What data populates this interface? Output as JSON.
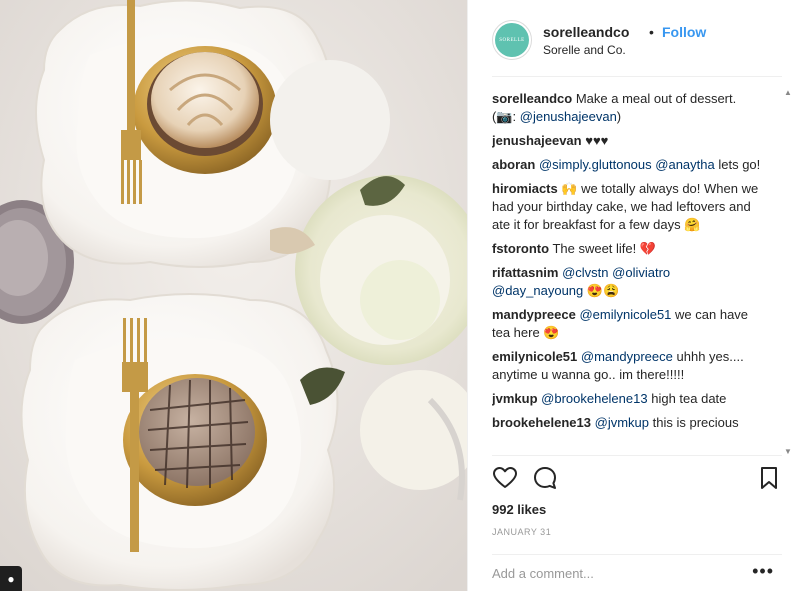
{
  "header": {
    "username": "sorelleandco",
    "separator": "•",
    "follow_label": "Follow",
    "subtitle": "Sorelle and Co.",
    "avatar_text": "SORELLE"
  },
  "caption": {
    "user": "sorelleandco",
    "text": "Make a meal out of dessert.",
    "text2_pre": "(📷: ",
    "text2_mention": "@jenushajeevan",
    "text2_post": ")"
  },
  "comments": [
    {
      "user": "jenushajeevan",
      "text": "♥♥♥"
    },
    {
      "user": "aboran",
      "m1": "@simply.gluttonous",
      "m2": "@anaytha",
      "text": "lets go!"
    },
    {
      "user": "hiromiacts",
      "text": "🙌 we totally always do! When we had your birthday cake, we had leftovers and ate it for breakfast for a few days 🤗"
    },
    {
      "user": "fstoronto",
      "text": "The sweet life! 💔"
    },
    {
      "user": "rifattasnim",
      "m1": "@clvstn",
      "m2": "@oliviatro",
      "m3": "@day_nayoung",
      "text": "😍😩"
    },
    {
      "user": "mandypreece",
      "m1": "@emilynicole51",
      "text": "we can have tea here 😍"
    },
    {
      "user": "emilynicole51",
      "m1": "@mandypreece",
      "text": "uhhh yes.... anytime u wanna go.. im there!!!!!"
    },
    {
      "user": "jvmkup",
      "m1": "@brookehelene13",
      "text": "high tea date"
    },
    {
      "user": "brookehelene13",
      "m1": "@jvmkup",
      "text": "this is precious"
    }
  ],
  "stats": {
    "likes": "992 likes",
    "date": "JANUARY 31"
  },
  "add_comment": {
    "placeholder": "Add a comment...",
    "more_label": "•••"
  },
  "icons": [
    "heart-icon",
    "comment-icon",
    "bookmark-icon",
    "user-tag-icon",
    "more-icon"
  ],
  "colors": {
    "accent": "#3897f0",
    "mention": "#003569",
    "border": "#efefef",
    "avatar": "#5fc2b0"
  }
}
